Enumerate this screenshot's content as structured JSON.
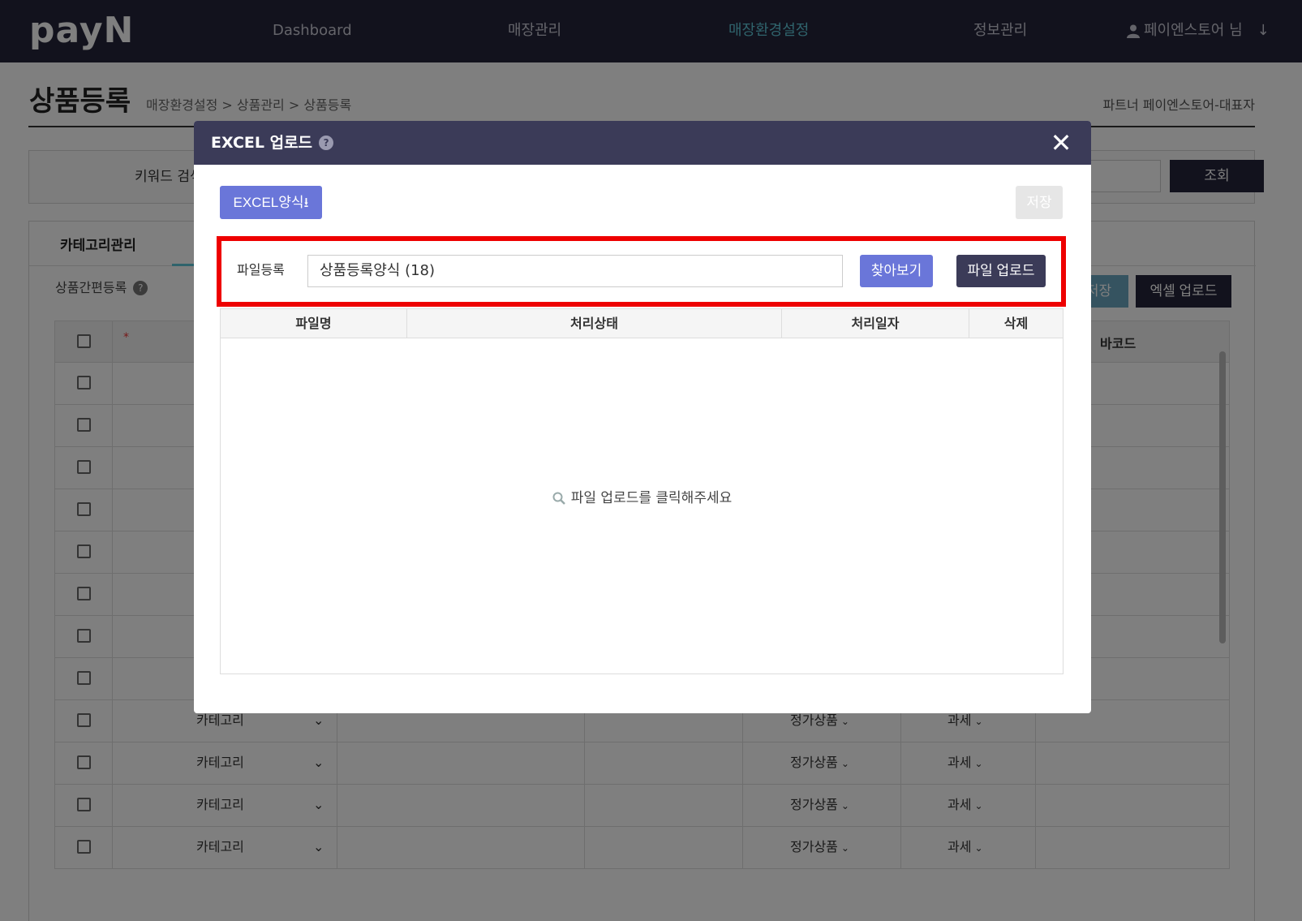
{
  "nav": {
    "logo": "payN",
    "items": [
      {
        "label": "Dashboard"
      },
      {
        "label": "매장관리"
      },
      {
        "label": "매장환경설정"
      },
      {
        "label": "정보관리"
      }
    ],
    "active_color": "#5fc6d8",
    "user": "페이엔스토어 님"
  },
  "page": {
    "title": "상품등록",
    "breadcrumb": "매장환경설정 > 상품관리 > 상품등록",
    "partner": "파트너 페이엔스토어-대표자"
  },
  "search": {
    "keyword_label": "키워드 검색",
    "search_button": "조회"
  },
  "panel": {
    "tab_label": "카테고리관리",
    "quick_register": "상품간편등록",
    "save_button": "저장",
    "excel_upload_button": "엑셀 업로드",
    "grid_header_barcode": "바코드",
    "required_mark": "*",
    "rows": [
      {
        "category": "카테고리",
        "product_type": "정가상품",
        "tax": "과세"
      },
      {
        "category": "카테고리",
        "product_type": "정가상품",
        "tax": "과세"
      },
      {
        "category": "카테고리",
        "product_type": "정가상품",
        "tax": "과세"
      },
      {
        "category": "카테고리",
        "product_type": "정가상품",
        "tax": "과세"
      }
    ]
  },
  "modal": {
    "title": "EXCEL 업로드",
    "help_icon": "question-icon",
    "close_icon": "close-icon",
    "template_button": "EXCEL양식",
    "save_button": "저장",
    "file_label": "파일등록",
    "file_value": "상품등록양식 (18)",
    "browse_button": "찾아보기",
    "upload_button": "파일 업로드",
    "highlight_color": "#ee0000",
    "table": {
      "columns": [
        "파일명",
        "처리상태",
        "처리일자",
        "삭제"
      ],
      "empty_message": "파일 업로드를 클릭해주세요"
    }
  }
}
